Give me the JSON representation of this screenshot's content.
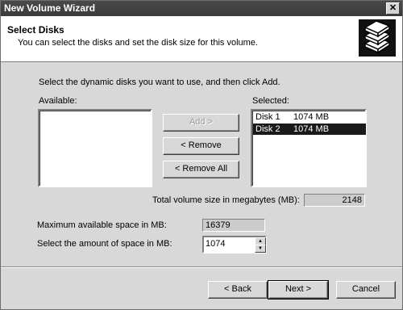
{
  "window": {
    "title": "New Volume Wizard",
    "close_icon": "close-icon"
  },
  "header": {
    "title": "Select Disks",
    "subtitle": "You can select the disks and set the disk size for this volume.",
    "icon": "disks-icon"
  },
  "instruction": "Select the dynamic disks you want to use, and then click Add.",
  "available": {
    "label": "Available:",
    "items": []
  },
  "selected": {
    "label": "Selected:",
    "items": [
      {
        "name": "Disk 1",
        "size": "1074 MB"
      },
      {
        "name": "Disk 2",
        "size": "1074 MB",
        "selected": true
      }
    ]
  },
  "buttons": {
    "add": "Add >",
    "remove": "< Remove",
    "remove_all": "< Remove All"
  },
  "total": {
    "label": "Total volume size in megabytes (MB):",
    "value": "2148"
  },
  "max_space": {
    "label": "Maximum available space in MB:",
    "value": "16379"
  },
  "amount": {
    "label": "Select the amount of space in MB:",
    "value": "1074"
  },
  "footer": {
    "back": "< Back",
    "next": "Next >",
    "cancel": "Cancel"
  }
}
